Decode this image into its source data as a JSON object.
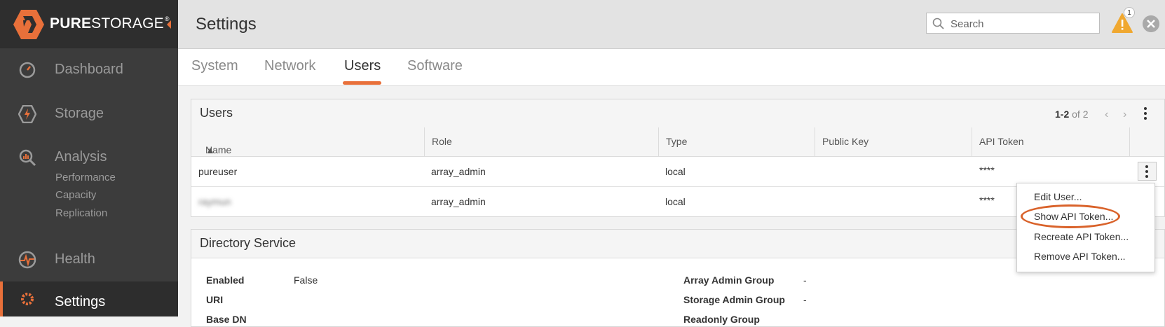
{
  "brand": {
    "logo_bold": "PURE",
    "logo_light": "STORAGE",
    "logo_mark": "®",
    "accent": "#e8703a"
  },
  "sidebar": {
    "items": [
      {
        "label": "Dashboard",
        "icon": "dashboard-gauge-icon"
      },
      {
        "label": "Storage",
        "icon": "storage-bolt-icon"
      },
      {
        "label": "Analysis",
        "icon": "analysis-magnifier-icon",
        "subitems": [
          "Performance",
          "Capacity",
          "Replication"
        ]
      },
      {
        "label": "Health",
        "icon": "health-pulse-icon"
      },
      {
        "label": "Settings",
        "icon": "settings-gear-icon",
        "active": true
      }
    ]
  },
  "header": {
    "title": "Settings",
    "search_placeholder": "Search",
    "alert_count": "1"
  },
  "tabs": [
    {
      "label": "System"
    },
    {
      "label": "Network"
    },
    {
      "label": "Users",
      "active": true
    },
    {
      "label": "Software"
    }
  ],
  "users_panel": {
    "title": "Users",
    "pager_range": "1-2",
    "pager_of": "of 2",
    "columns": [
      "Name",
      "Role",
      "Type",
      "Public Key",
      "API Token"
    ],
    "rows": [
      {
        "name": "pureuser",
        "role": "array_admin",
        "type": "local",
        "public_key": "",
        "api_token": "****"
      },
      {
        "name": "raymun",
        "name_obscured": true,
        "role": "array_admin",
        "type": "local",
        "public_key": "",
        "api_token": "****"
      }
    ]
  },
  "directory_panel": {
    "title": "Directory Service",
    "fields": {
      "enabled_label": "Enabled",
      "enabled_value": "False",
      "uri_label": "URI",
      "base_dn_label": "Base DN",
      "array_admin_group_label": "Array Admin Group",
      "array_admin_group_value": "-",
      "storage_admin_group_label": "Storage Admin Group",
      "storage_admin_group_value": "-",
      "readonly_group_label": "Readonly Group"
    }
  },
  "context_menu": {
    "items": [
      "Edit User...",
      "Show API Token...",
      "Recreate API Token...",
      "Remove API Token..."
    ],
    "highlighted": "Show API Token..."
  }
}
